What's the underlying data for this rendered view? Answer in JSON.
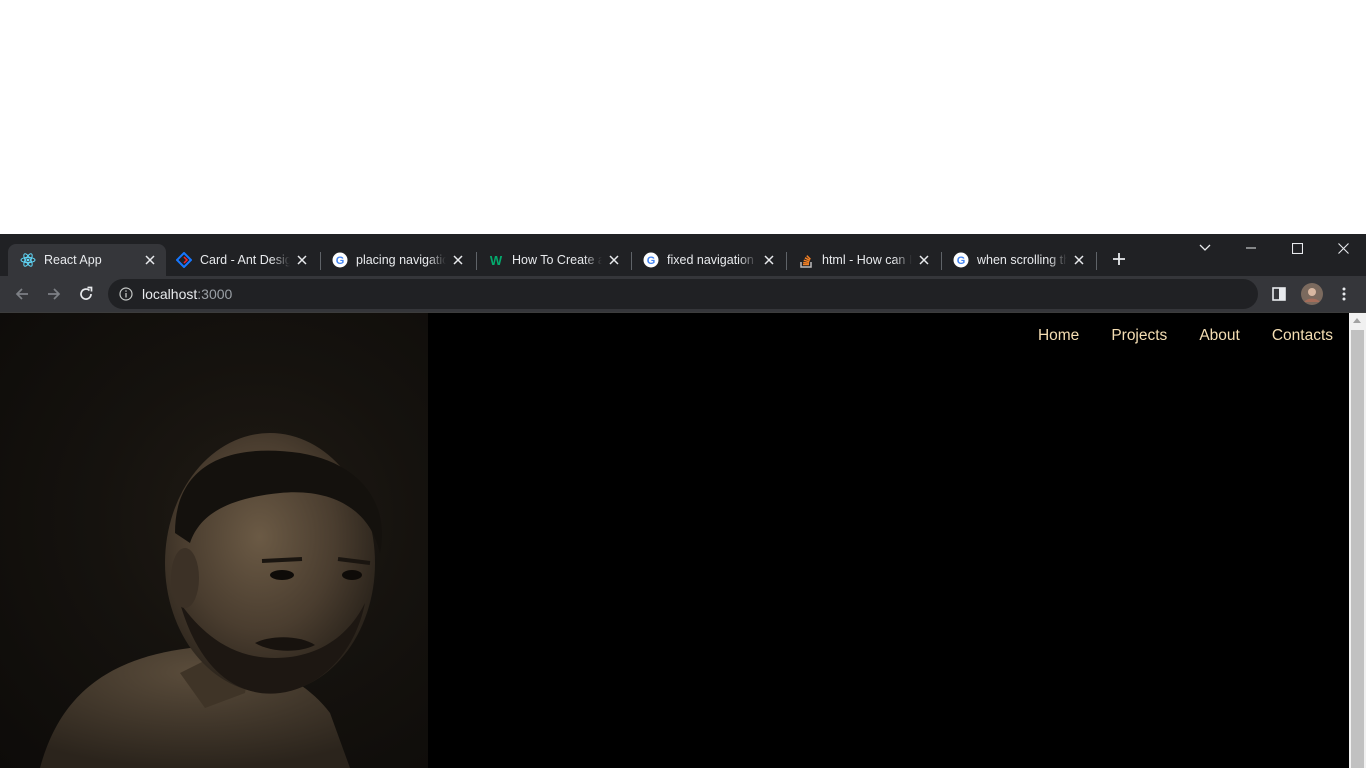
{
  "browser": {
    "tabs": [
      {
        "title": "React App",
        "favicon": "react-icon",
        "active": true
      },
      {
        "title": "Card - Ant Design",
        "favicon": "ant-design-icon",
        "active": false
      },
      {
        "title": "placing navigation",
        "favicon": "google-icon",
        "active": false
      },
      {
        "title": "How To Create a",
        "favicon": "w3schools-icon",
        "active": false
      },
      {
        "title": "fixed navigation bar",
        "favicon": "google-icon",
        "active": false
      },
      {
        "title": "html - How can I",
        "favicon": "stackoverflow-icon",
        "active": false
      },
      {
        "title": "when scrolling the",
        "favicon": "google-icon",
        "active": false
      }
    ],
    "address": {
      "host": "localhost",
      "port": ":3000"
    }
  },
  "site": {
    "nav": [
      {
        "label": "Home"
      },
      {
        "label": "Projects"
      },
      {
        "label": "About"
      },
      {
        "label": "Contacts"
      }
    ]
  },
  "colors": {
    "tabstrip": "#202124",
    "toolbar": "#35363a",
    "page_bg": "#000000",
    "nav_text": "#f5deb3"
  }
}
